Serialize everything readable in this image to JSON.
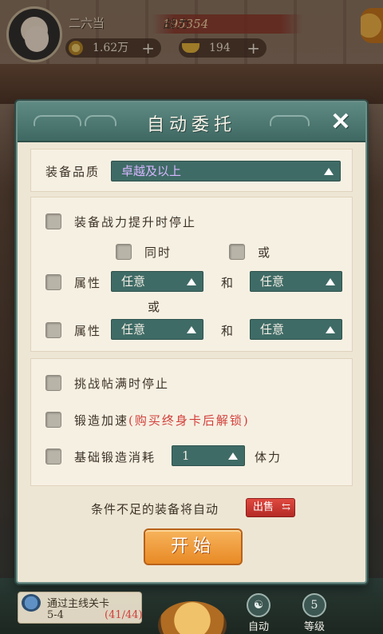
{
  "hud": {
    "player_name": "二六当",
    "power_label": "战力",
    "power_value": "195354",
    "copper": "1.62万",
    "ingot": "194"
  },
  "dialog": {
    "title": "自动委托",
    "close_glyph": "✕",
    "quality_label": "装备品质",
    "quality_value": "卓越及以上",
    "stop_on_power_up": "装备战力提升时停止",
    "mode_and": "同时",
    "mode_or": "或",
    "attr_label": "属性",
    "any": "任意",
    "and_word": "和",
    "or_word": "或",
    "stop_on_ticket_full": "挑战帖满时停止",
    "forge_speed": "锻造加速",
    "forge_speed_note": "(购买终身卡后解锁)",
    "base_forge_cost": "基础锻造消耗",
    "base_forge_value": "1",
    "stamina": "体力",
    "auto_sell_note": "条件不足的装备将自动",
    "sell_button": "出售",
    "start_button": "开始"
  },
  "bottom": {
    "mission_title": "通过主线关卡",
    "mission_stage": "5-4",
    "mission_progress": "(41/44)",
    "auto_label": "自动",
    "level_value": "5",
    "level_label": "等级"
  },
  "colors": {
    "header": "#4e7a74",
    "select_bg": "#3f6b66",
    "panel_bg": "#eee6d4",
    "start_button": "#f0a040",
    "sell_button": "#c9362f",
    "note_red": "#d23f3a"
  }
}
